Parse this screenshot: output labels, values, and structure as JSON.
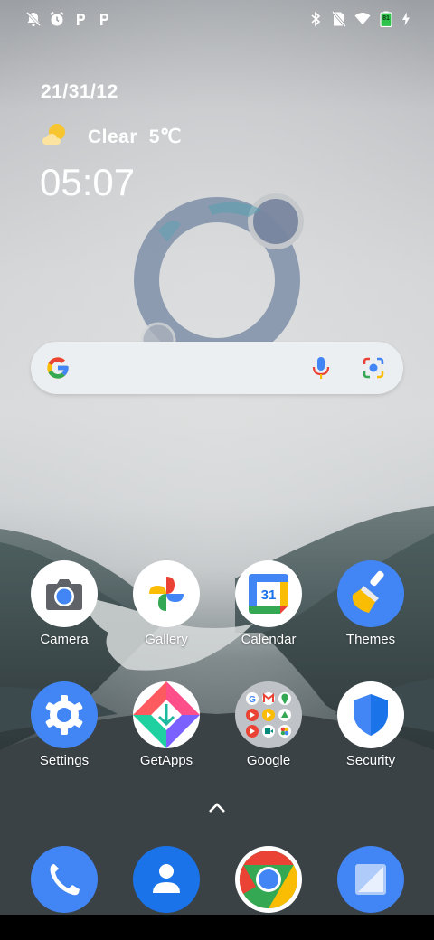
{
  "status_bar": {
    "left_icons": [
      "mute-icon",
      "alarm-icon",
      "p-notification-icon",
      "p-notification-icon"
    ],
    "right_icons": [
      "bluetooth-icon",
      "no-sim-icon",
      "wifi-icon",
      "battery-icon",
      "charging-icon"
    ],
    "battery_level": "81"
  },
  "widget": {
    "date": "21/31/12",
    "weather_icon": "sun-cloud-icon",
    "weather": "Clear  5℃",
    "time": "05:07"
  },
  "search": {
    "logo": "google-g-icon",
    "mic": "mic-icon",
    "lens": "lens-icon"
  },
  "apps": [
    {
      "label": "Camera",
      "icon": "camera-icon"
    },
    {
      "label": "Gallery",
      "icon": "gallery-icon"
    },
    {
      "label": "Calendar",
      "icon": "calendar-icon",
      "badge": "31"
    },
    {
      "label": "Themes",
      "icon": "themes-icon"
    },
    {
      "label": "Settings",
      "icon": "settings-icon"
    },
    {
      "label": "GetApps",
      "icon": "getapps-icon"
    },
    {
      "label": "Google",
      "icon": "google-folder-icon"
    },
    {
      "label": "Security",
      "icon": "security-icon"
    }
  ],
  "dock": [
    {
      "icon": "phone-icon"
    },
    {
      "icon": "contacts-icon"
    },
    {
      "icon": "chrome-icon"
    },
    {
      "icon": "messages-icon"
    }
  ],
  "colors": {
    "accent_blue": "#4285f4",
    "google_red": "#ea4335",
    "google_yellow": "#fbbc04",
    "google_green": "#34a853"
  }
}
